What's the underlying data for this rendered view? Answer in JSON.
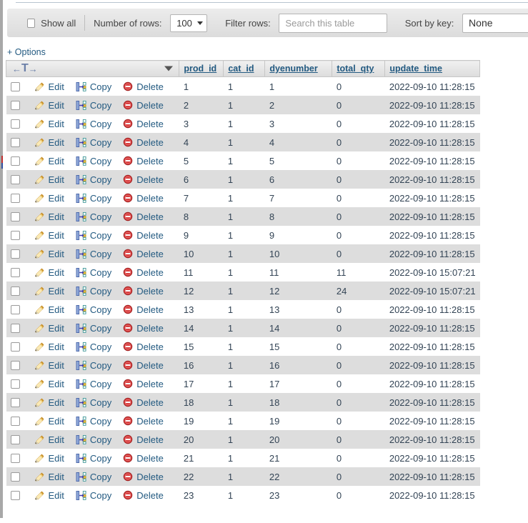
{
  "toolbar": {
    "show_all_label": "Show all",
    "number_of_rows_label": "Number of rows:",
    "rows_value": "100",
    "filter_rows_label": "Filter rows:",
    "filter_placeholder": "Search this table",
    "filter_value": "",
    "sort_by_key_label": "Sort by key:",
    "sort_key_value": "None"
  },
  "options_link": "+ Options",
  "table": {
    "nav_glyph_left": "←",
    "nav_glyph_center": "T",
    "nav_glyph_right": "→",
    "columns": [
      "prod_id",
      "cat_id",
      "dyenumber",
      "total_qty",
      "update_time"
    ],
    "actions": {
      "edit_label": "Edit",
      "copy_label": "Copy",
      "delete_label": "Delete"
    },
    "rows": [
      {
        "prod_id": "1",
        "cat_id": "1",
        "dyenumber": "1",
        "total_qty": "0",
        "update_time": "2022-09-10 11:28:15"
      },
      {
        "prod_id": "2",
        "cat_id": "1",
        "dyenumber": "2",
        "total_qty": "0",
        "update_time": "2022-09-10 11:28:15"
      },
      {
        "prod_id": "3",
        "cat_id": "1",
        "dyenumber": "3",
        "total_qty": "0",
        "update_time": "2022-09-10 11:28:15"
      },
      {
        "prod_id": "4",
        "cat_id": "1",
        "dyenumber": "4",
        "total_qty": "0",
        "update_time": "2022-09-10 11:28:15"
      },
      {
        "prod_id": "5",
        "cat_id": "1",
        "dyenumber": "5",
        "total_qty": "0",
        "update_time": "2022-09-10 11:28:15"
      },
      {
        "prod_id": "6",
        "cat_id": "1",
        "dyenumber": "6",
        "total_qty": "0",
        "update_time": "2022-09-10 11:28:15"
      },
      {
        "prod_id": "7",
        "cat_id": "1",
        "dyenumber": "7",
        "total_qty": "0",
        "update_time": "2022-09-10 11:28:15"
      },
      {
        "prod_id": "8",
        "cat_id": "1",
        "dyenumber": "8",
        "total_qty": "0",
        "update_time": "2022-09-10 11:28:15"
      },
      {
        "prod_id": "9",
        "cat_id": "1",
        "dyenumber": "9",
        "total_qty": "0",
        "update_time": "2022-09-10 11:28:15"
      },
      {
        "prod_id": "10",
        "cat_id": "1",
        "dyenumber": "10",
        "total_qty": "0",
        "update_time": "2022-09-10 11:28:15"
      },
      {
        "prod_id": "11",
        "cat_id": "1",
        "dyenumber": "11",
        "total_qty": "11",
        "update_time": "2022-09-10 15:07:21"
      },
      {
        "prod_id": "12",
        "cat_id": "1",
        "dyenumber": "12",
        "total_qty": "24",
        "update_time": "2022-09-10 15:07:21"
      },
      {
        "prod_id": "13",
        "cat_id": "1",
        "dyenumber": "13",
        "total_qty": "0",
        "update_time": "2022-09-10 11:28:15"
      },
      {
        "prod_id": "14",
        "cat_id": "1",
        "dyenumber": "14",
        "total_qty": "0",
        "update_time": "2022-09-10 11:28:15"
      },
      {
        "prod_id": "15",
        "cat_id": "1",
        "dyenumber": "15",
        "total_qty": "0",
        "update_time": "2022-09-10 11:28:15"
      },
      {
        "prod_id": "16",
        "cat_id": "1",
        "dyenumber": "16",
        "total_qty": "0",
        "update_time": "2022-09-10 11:28:15"
      },
      {
        "prod_id": "17",
        "cat_id": "1",
        "dyenumber": "17",
        "total_qty": "0",
        "update_time": "2022-09-10 11:28:15"
      },
      {
        "prod_id": "18",
        "cat_id": "1",
        "dyenumber": "18",
        "total_qty": "0",
        "update_time": "2022-09-10 11:28:15"
      },
      {
        "prod_id": "19",
        "cat_id": "1",
        "dyenumber": "19",
        "total_qty": "0",
        "update_time": "2022-09-10 11:28:15"
      },
      {
        "prod_id": "20",
        "cat_id": "1",
        "dyenumber": "20",
        "total_qty": "0",
        "update_time": "2022-09-10 11:28:15"
      },
      {
        "prod_id": "21",
        "cat_id": "1",
        "dyenumber": "21",
        "total_qty": "0",
        "update_time": "2022-09-10 11:28:15"
      },
      {
        "prod_id": "22",
        "cat_id": "1",
        "dyenumber": "22",
        "total_qty": "0",
        "update_time": "2022-09-10 11:28:15"
      },
      {
        "prod_id": "23",
        "cat_id": "1",
        "dyenumber": "23",
        "total_qty": "0",
        "update_time": "2022-09-10 11:28:15"
      }
    ]
  },
  "colors": {
    "link": "#235a81",
    "row_alt": "#dddddd",
    "toolbar_bg": "#e3e3e3",
    "delete_icon": "#d33a3a",
    "edit_icon": "#e8b23a"
  }
}
